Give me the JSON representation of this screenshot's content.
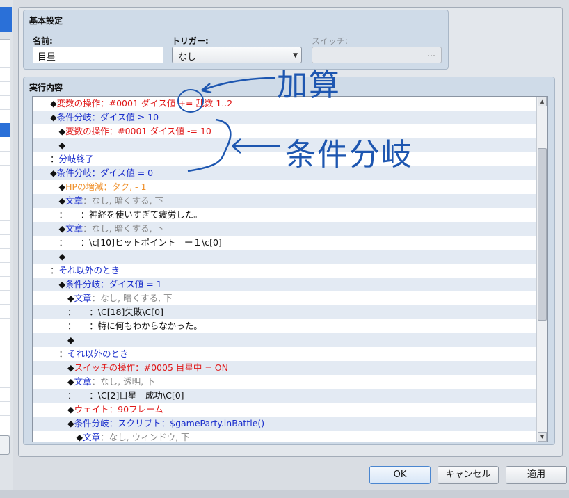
{
  "basic_settings": {
    "title": "基本設定",
    "name_label": "名前:",
    "name_value": "目星",
    "trigger_label": "トリガー:",
    "trigger_value": "なし",
    "switch_label": "スイッチ:",
    "switch_value": ""
  },
  "execution": {
    "title": "実行内容",
    "rows": [
      [
        {
          "t": "　　◆",
          "c": "black"
        },
        {
          "t": "変数の操作：#0001 ダイス値 += 乱数 1..2",
          "c": "red"
        }
      ],
      [
        {
          "t": "　　◆",
          "c": "black"
        },
        {
          "t": "条件分岐：ダイス値 ≥ 10",
          "c": "blue"
        }
      ],
      [
        {
          "t": "　　　◆",
          "c": "black"
        },
        {
          "t": "変数の操作：#0001 ダイス値 -= 10",
          "c": "red"
        }
      ],
      [
        {
          "t": "　　　◆",
          "c": "black"
        }
      ],
      [
        {
          "t": "　　：",
          "c": "black"
        },
        {
          "t": "分岐終了",
          "c": "blue"
        }
      ],
      [
        {
          "t": "　　◆",
          "c": "black"
        },
        {
          "t": "条件分岐：ダイス値 = 0",
          "c": "blue"
        }
      ],
      [
        {
          "t": "　　　◆",
          "c": "black"
        },
        {
          "t": "HPの増減：タク, - 1",
          "c": "orange"
        }
      ],
      [
        {
          "t": "　　　◆",
          "c": "black"
        },
        {
          "t": "文章",
          "c": "blue"
        },
        {
          "t": "：なし, 暗くする, 下",
          "c": "gray"
        }
      ],
      [
        {
          "t": "　　　：　　：",
          "c": "black"
        },
        {
          "t": "神経を使いすぎて疲労した。",
          "c": "black"
        }
      ],
      [
        {
          "t": "　　　◆",
          "c": "black"
        },
        {
          "t": "文章",
          "c": "blue"
        },
        {
          "t": "：なし, 暗くする, 下",
          "c": "gray"
        }
      ],
      [
        {
          "t": "　　　：　　：",
          "c": "black"
        },
        {
          "t": "\\c[10]ヒットポイント　ー１\\c[0]",
          "c": "black"
        }
      ],
      [
        {
          "t": "　　　◆",
          "c": "black"
        }
      ],
      [
        {
          "t": "　　：",
          "c": "black"
        },
        {
          "t": "それ以外のとき",
          "c": "blue"
        }
      ],
      [
        {
          "t": "　　　◆",
          "c": "black"
        },
        {
          "t": "条件分岐：ダイス値 = 1",
          "c": "blue"
        }
      ],
      [
        {
          "t": "　　　　◆",
          "c": "black"
        },
        {
          "t": "文章",
          "c": "blue"
        },
        {
          "t": "：なし, 暗くする, 下",
          "c": "gray"
        }
      ],
      [
        {
          "t": "　　　　：　　：",
          "c": "black"
        },
        {
          "t": "\\C[18]失敗\\C[0]",
          "c": "black"
        }
      ],
      [
        {
          "t": "　　　　：　　：",
          "c": "black"
        },
        {
          "t": "特に何もわからなかった。",
          "c": "black"
        }
      ],
      [
        {
          "t": "　　　　◆",
          "c": "black"
        }
      ],
      [
        {
          "t": "　　　：",
          "c": "black"
        },
        {
          "t": "それ以外のとき",
          "c": "blue"
        }
      ],
      [
        {
          "t": "　　　　◆",
          "c": "black"
        },
        {
          "t": "スイッチの操作：#0005 目星中 = ON",
          "c": "red"
        }
      ],
      [
        {
          "t": "　　　　◆",
          "c": "black"
        },
        {
          "t": "文章",
          "c": "blue"
        },
        {
          "t": "：なし, 透明, 下",
          "c": "gray"
        }
      ],
      [
        {
          "t": "　　　　：　　：",
          "c": "black"
        },
        {
          "t": "\\C[2]目星　成功\\C[0]",
          "c": "black"
        }
      ],
      [
        {
          "t": "　　　　◆",
          "c": "black"
        },
        {
          "t": "ウェイト：90フレーム",
          "c": "red"
        }
      ],
      [
        {
          "t": "　　　　◆",
          "c": "black"
        },
        {
          "t": "条件分岐：スクリプト：$gameParty.inBattle()",
          "c": "blue"
        }
      ],
      [
        {
          "t": "　　　　　◆",
          "c": "black"
        },
        {
          "t": "文章",
          "c": "blue"
        },
        {
          "t": "：なし, ウィンドウ, 下",
          "c": "gray"
        }
      ]
    ]
  },
  "buttons": {
    "ok": "OK",
    "cancel": "キャンセル",
    "apply": "適用"
  },
  "annotations": {
    "addition": "加算",
    "branch": "条件分岐"
  },
  "colors": {
    "red": "#e01818",
    "blue": "#1a2ecc",
    "orange": "#f0902a",
    "gray": "#888888",
    "black": "#111111",
    "annotation": "#1d56b0"
  },
  "icons": {
    "trigger_dropdown": "chevron-down-icon",
    "switch_picker": "ellipsis-icon",
    "scroll_up": "scroll-up-arrow-icon",
    "scroll_down": "scroll-down-arrow-icon"
  }
}
